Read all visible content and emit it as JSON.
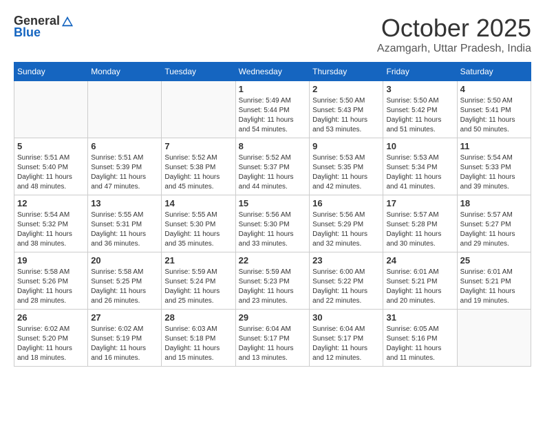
{
  "logo": {
    "general": "General",
    "blue": "Blue"
  },
  "title": {
    "month": "October 2025",
    "location": "Azamgarh, Uttar Pradesh, India"
  },
  "weekdays": [
    "Sunday",
    "Monday",
    "Tuesday",
    "Wednesday",
    "Thursday",
    "Friday",
    "Saturday"
  ],
  "weeks": [
    [
      {
        "day": "",
        "info": ""
      },
      {
        "day": "",
        "info": ""
      },
      {
        "day": "",
        "info": ""
      },
      {
        "day": "1",
        "info": "Sunrise: 5:49 AM\nSunset: 5:44 PM\nDaylight: 11 hours\nand 54 minutes."
      },
      {
        "day": "2",
        "info": "Sunrise: 5:50 AM\nSunset: 5:43 PM\nDaylight: 11 hours\nand 53 minutes."
      },
      {
        "day": "3",
        "info": "Sunrise: 5:50 AM\nSunset: 5:42 PM\nDaylight: 11 hours\nand 51 minutes."
      },
      {
        "day": "4",
        "info": "Sunrise: 5:50 AM\nSunset: 5:41 PM\nDaylight: 11 hours\nand 50 minutes."
      }
    ],
    [
      {
        "day": "5",
        "info": "Sunrise: 5:51 AM\nSunset: 5:40 PM\nDaylight: 11 hours\nand 48 minutes."
      },
      {
        "day": "6",
        "info": "Sunrise: 5:51 AM\nSunset: 5:39 PM\nDaylight: 11 hours\nand 47 minutes."
      },
      {
        "day": "7",
        "info": "Sunrise: 5:52 AM\nSunset: 5:38 PM\nDaylight: 11 hours\nand 45 minutes."
      },
      {
        "day": "8",
        "info": "Sunrise: 5:52 AM\nSunset: 5:37 PM\nDaylight: 11 hours\nand 44 minutes."
      },
      {
        "day": "9",
        "info": "Sunrise: 5:53 AM\nSunset: 5:35 PM\nDaylight: 11 hours\nand 42 minutes."
      },
      {
        "day": "10",
        "info": "Sunrise: 5:53 AM\nSunset: 5:34 PM\nDaylight: 11 hours\nand 41 minutes."
      },
      {
        "day": "11",
        "info": "Sunrise: 5:54 AM\nSunset: 5:33 PM\nDaylight: 11 hours\nand 39 minutes."
      }
    ],
    [
      {
        "day": "12",
        "info": "Sunrise: 5:54 AM\nSunset: 5:32 PM\nDaylight: 11 hours\nand 38 minutes."
      },
      {
        "day": "13",
        "info": "Sunrise: 5:55 AM\nSunset: 5:31 PM\nDaylight: 11 hours\nand 36 minutes."
      },
      {
        "day": "14",
        "info": "Sunrise: 5:55 AM\nSunset: 5:30 PM\nDaylight: 11 hours\nand 35 minutes."
      },
      {
        "day": "15",
        "info": "Sunrise: 5:56 AM\nSunset: 5:30 PM\nDaylight: 11 hours\nand 33 minutes."
      },
      {
        "day": "16",
        "info": "Sunrise: 5:56 AM\nSunset: 5:29 PM\nDaylight: 11 hours\nand 32 minutes."
      },
      {
        "day": "17",
        "info": "Sunrise: 5:57 AM\nSunset: 5:28 PM\nDaylight: 11 hours\nand 30 minutes."
      },
      {
        "day": "18",
        "info": "Sunrise: 5:57 AM\nSunset: 5:27 PM\nDaylight: 11 hours\nand 29 minutes."
      }
    ],
    [
      {
        "day": "19",
        "info": "Sunrise: 5:58 AM\nSunset: 5:26 PM\nDaylight: 11 hours\nand 28 minutes."
      },
      {
        "day": "20",
        "info": "Sunrise: 5:58 AM\nSunset: 5:25 PM\nDaylight: 11 hours\nand 26 minutes."
      },
      {
        "day": "21",
        "info": "Sunrise: 5:59 AM\nSunset: 5:24 PM\nDaylight: 11 hours\nand 25 minutes."
      },
      {
        "day": "22",
        "info": "Sunrise: 5:59 AM\nSunset: 5:23 PM\nDaylight: 11 hours\nand 23 minutes."
      },
      {
        "day": "23",
        "info": "Sunrise: 6:00 AM\nSunset: 5:22 PM\nDaylight: 11 hours\nand 22 minutes."
      },
      {
        "day": "24",
        "info": "Sunrise: 6:01 AM\nSunset: 5:21 PM\nDaylight: 11 hours\nand 20 minutes."
      },
      {
        "day": "25",
        "info": "Sunrise: 6:01 AM\nSunset: 5:21 PM\nDaylight: 11 hours\nand 19 minutes."
      }
    ],
    [
      {
        "day": "26",
        "info": "Sunrise: 6:02 AM\nSunset: 5:20 PM\nDaylight: 11 hours\nand 18 minutes."
      },
      {
        "day": "27",
        "info": "Sunrise: 6:02 AM\nSunset: 5:19 PM\nDaylight: 11 hours\nand 16 minutes."
      },
      {
        "day": "28",
        "info": "Sunrise: 6:03 AM\nSunset: 5:18 PM\nDaylight: 11 hours\nand 15 minutes."
      },
      {
        "day": "29",
        "info": "Sunrise: 6:04 AM\nSunset: 5:17 PM\nDaylight: 11 hours\nand 13 minutes."
      },
      {
        "day": "30",
        "info": "Sunrise: 6:04 AM\nSunset: 5:17 PM\nDaylight: 11 hours\nand 12 minutes."
      },
      {
        "day": "31",
        "info": "Sunrise: 6:05 AM\nSunset: 5:16 PM\nDaylight: 11 hours\nand 11 minutes."
      },
      {
        "day": "",
        "info": ""
      }
    ]
  ]
}
